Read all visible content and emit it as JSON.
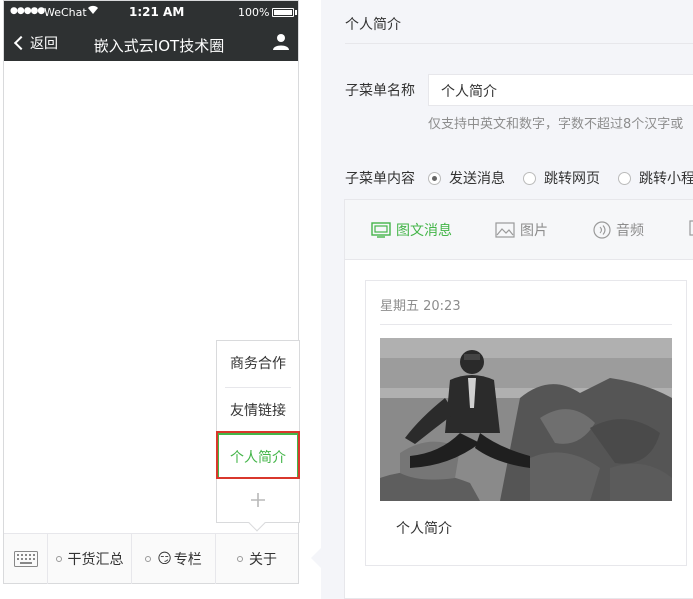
{
  "phone": {
    "status": {
      "signal": "●●●●●",
      "carrier": "WeChat",
      "time": "1:21 AM",
      "battery": "100%"
    },
    "nav": {
      "back_label": "返回",
      "title": "嵌入式云IOT技术圈"
    },
    "submenu": {
      "items": [
        "商务合作",
        "友情链接",
        "个人简介"
      ],
      "active_index": 2
    },
    "menubar": {
      "items": [
        {
          "label": "干货汇总",
          "emoji": ""
        },
        {
          "label": "专栏",
          "emoji": "😏"
        },
        {
          "label": "关于",
          "emoji": ""
        }
      ]
    }
  },
  "editor": {
    "header": "个人简介",
    "name_label": "子菜单名称",
    "name_value": "个人简介",
    "name_hint": "仅支持中英文和数字，字数不超过8个汉字或",
    "content_label": "子菜单内容",
    "radios": [
      {
        "label": "发送消息",
        "checked": true
      },
      {
        "label": "跳转网页",
        "checked": false
      },
      {
        "label": "跳转小程",
        "checked": false
      }
    ],
    "tabs": [
      {
        "label": "图文消息",
        "icon": "news-icon",
        "active": true
      },
      {
        "label": "图片",
        "icon": "image-icon",
        "active": false
      },
      {
        "label": "音频",
        "icon": "audio-icon",
        "active": false
      }
    ],
    "card": {
      "date": "星期五 20:23",
      "caption": "个人简介"
    }
  },
  "colors": {
    "wechat_green": "#44b549",
    "highlight_red": "#d9372c",
    "bar_dark": "#2e3132"
  }
}
